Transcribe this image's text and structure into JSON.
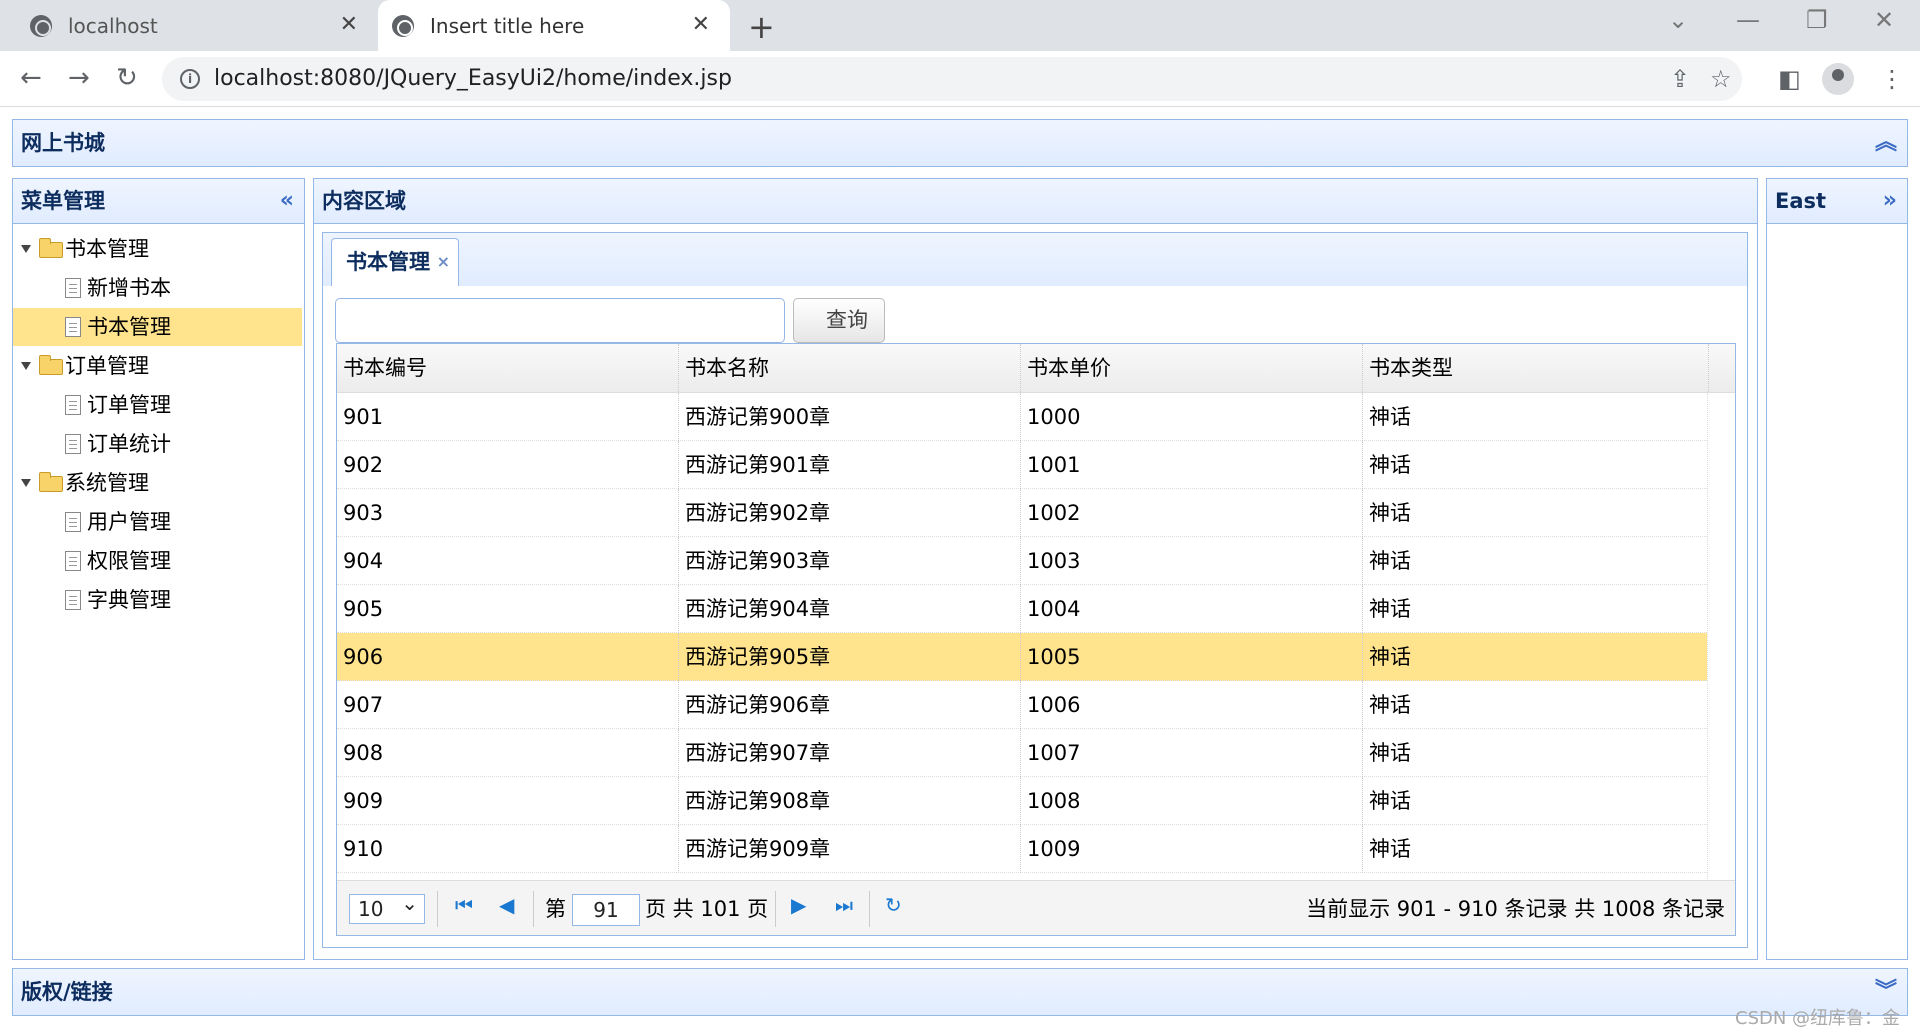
{
  "browser": {
    "tabs": [
      {
        "title": "localhost"
      },
      {
        "title": "Insert title here"
      }
    ],
    "url": "localhost:8080/JQuery_EasyUi2/home/index.jsp"
  },
  "north": {
    "title": "网上书城"
  },
  "west": {
    "title": "菜单管理",
    "tree": [
      {
        "label": "书本管理",
        "type": "folder"
      },
      {
        "label": "新增书本",
        "type": "leaf"
      },
      {
        "label": "书本管理",
        "type": "leaf",
        "selected": true
      },
      {
        "label": "订单管理",
        "type": "folder"
      },
      {
        "label": "订单管理",
        "type": "leaf"
      },
      {
        "label": "订单统计",
        "type": "leaf"
      },
      {
        "label": "系统管理",
        "type": "folder"
      },
      {
        "label": "用户管理",
        "type": "leaf"
      },
      {
        "label": "权限管理",
        "type": "leaf"
      },
      {
        "label": "字典管理",
        "type": "leaf"
      }
    ]
  },
  "center": {
    "title": "内容区域",
    "tab": {
      "label": "书本管理",
      "close": "×"
    },
    "search": {
      "value": "",
      "button": "查询"
    },
    "grid": {
      "columns": [
        "书本编号",
        "书本名称",
        "书本单价",
        "书本类型"
      ],
      "rows": [
        [
          "901",
          "西游记第900章",
          "1000",
          "神话"
        ],
        [
          "902",
          "西游记第901章",
          "1001",
          "神话"
        ],
        [
          "903",
          "西游记第902章",
          "1002",
          "神话"
        ],
        [
          "904",
          "西游记第903章",
          "1003",
          "神话"
        ],
        [
          "905",
          "西游记第904章",
          "1004",
          "神话"
        ],
        [
          "906",
          "西游记第905章",
          "1005",
          "神话"
        ],
        [
          "907",
          "西游记第906章",
          "1006",
          "神话"
        ],
        [
          "908",
          "西游记第907章",
          "1007",
          "神话"
        ],
        [
          "909",
          "西游记第908章",
          "1008",
          "神话"
        ],
        [
          "910",
          "西游记第909章",
          "1009",
          "神话"
        ]
      ],
      "selected_row": 5
    },
    "pager": {
      "page_size": "10",
      "page_prefix": "第",
      "page_number": "91",
      "page_suffix": "页 共 101 页",
      "info": "当前显示 901 - 910 条记录 共 1008 条记录"
    }
  },
  "east": {
    "title": "East"
  },
  "south": {
    "title": "版权/链接"
  },
  "watermark": "CSDN @纽库鲁：金"
}
